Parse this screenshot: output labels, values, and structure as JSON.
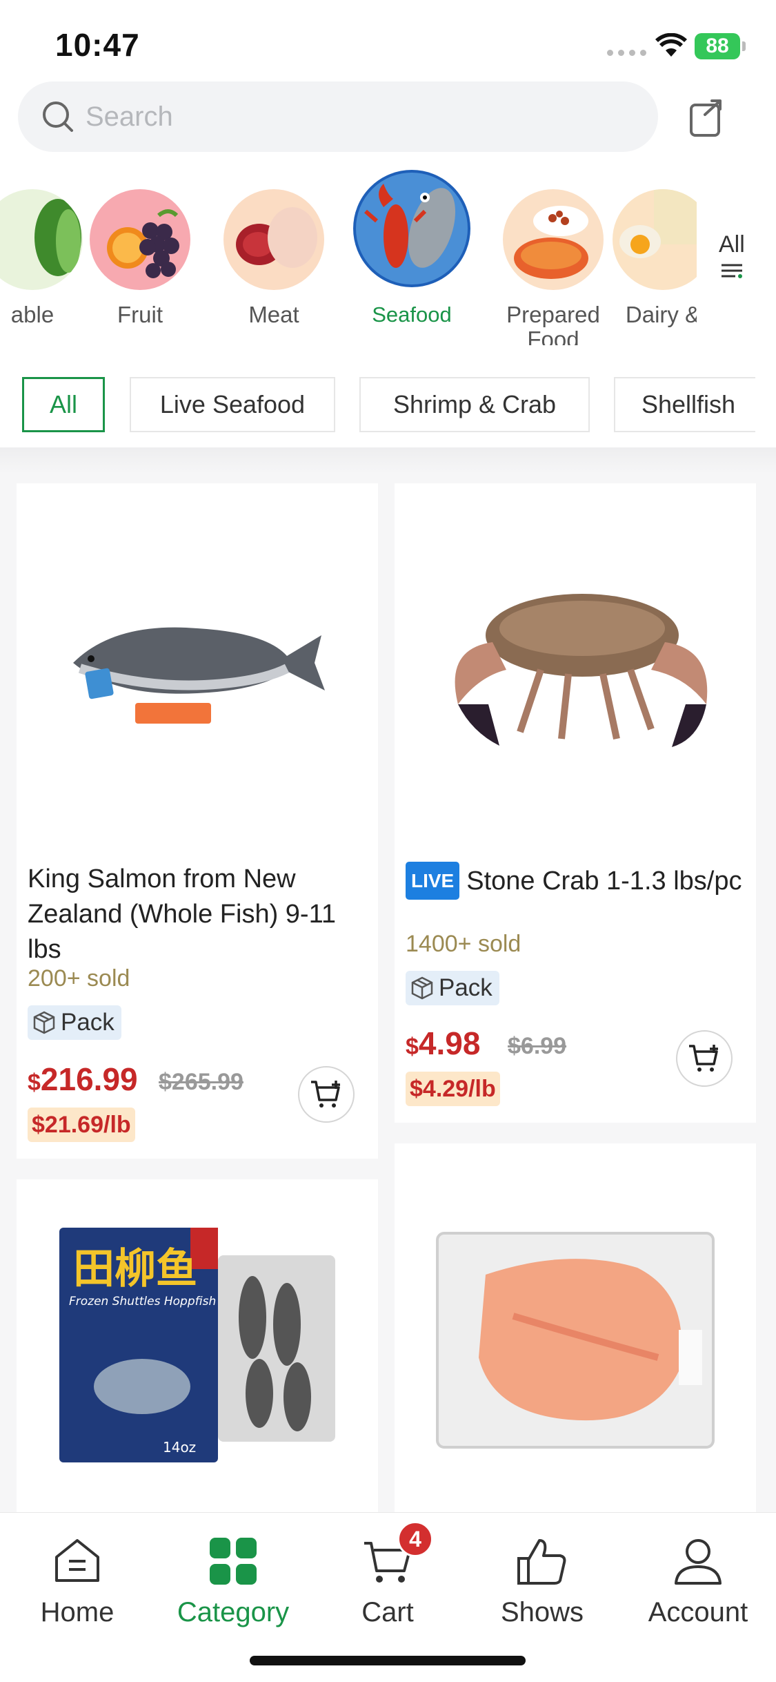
{
  "status": {
    "time": "10:47",
    "battery": "88"
  },
  "search": {
    "placeholder": "Search"
  },
  "categories": [
    {
      "label": "able"
    },
    {
      "label": "Fruit"
    },
    {
      "label": "Meat"
    },
    {
      "label": "Seafood",
      "selected": true
    },
    {
      "label": "Prepared Food"
    },
    {
      "label": "Dairy &"
    }
  ],
  "all_categories_label": "All",
  "subtabs": [
    "All",
    "Live Seafood",
    "Shrimp & Crab",
    "Shellfish"
  ],
  "products": [
    {
      "title": "King Salmon from New Zealand (Whole Fish) 9-11 lbs",
      "sold": "200+ sold",
      "pack": "Pack",
      "currency": "$",
      "price": "216.99",
      "original": "$265.99",
      "unit_price": "$21.69/lb"
    },
    {
      "badge": "LIVE",
      "title": "Stone Crab 1-1.3 lbs/pc",
      "sold": "1400+ sold",
      "pack": "Pack",
      "currency": "$",
      "price": "4.98",
      "original": "$6.99",
      "unit_price": "$4.29/lb"
    },
    {
      "package_text": "Frozen Shuttles Hoppfish",
      "package_weight": "14oz"
    },
    {}
  ],
  "nav": {
    "home": "Home",
    "category": "Category",
    "cart": "Cart",
    "cart_count": "4",
    "shows": "Shows",
    "account": "Account"
  },
  "colors": {
    "accent": "#1a9448",
    "price": "#c62828",
    "live": "#1d7fe0"
  }
}
